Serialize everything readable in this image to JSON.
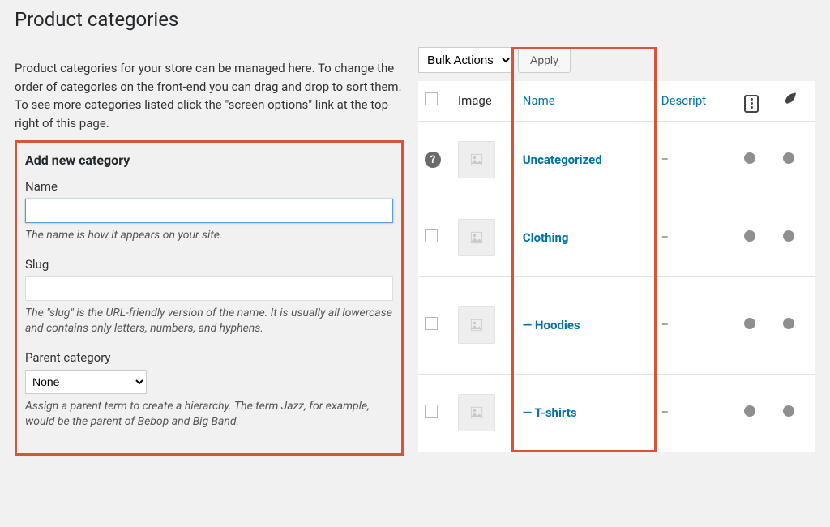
{
  "page_title": "Product categories",
  "intro_text": "Product categories for your store can be managed here. To change the order of categories on the front-end you can drag and drop to sort them. To see more categories listed click the \"screen options\" link at the top-right of this page.",
  "form": {
    "heading": "Add new category",
    "name_label": "Name",
    "name_value": "",
    "name_help": "The name is how it appears on your site.",
    "slug_label": "Slug",
    "slug_value": "",
    "slug_help": "The \"slug\" is the URL-friendly version of the name. It is usually all lowercase and contains only letters, numbers, and hyphens.",
    "parent_label": "Parent category",
    "parent_value": "None",
    "parent_help": "Assign a parent term to create a hierarchy. The term Jazz, for example, would be the parent of Bebop and Big Band."
  },
  "toolbar": {
    "bulk_label": "Bulk Actions",
    "apply_label": "Apply"
  },
  "table": {
    "headers": {
      "image": "Image",
      "name": "Name",
      "description": "Descript"
    },
    "rows": [
      {
        "name": "Uncategorized",
        "description": "–",
        "indent": false,
        "help_icon": true
      },
      {
        "name": "Clothing",
        "description": "–",
        "indent": false,
        "help_icon": false
      },
      {
        "name": "Hoodies",
        "description": "–",
        "indent": true,
        "help_icon": false
      },
      {
        "name": "T-shirts",
        "description": "–",
        "indent": true,
        "help_icon": false
      }
    ]
  }
}
